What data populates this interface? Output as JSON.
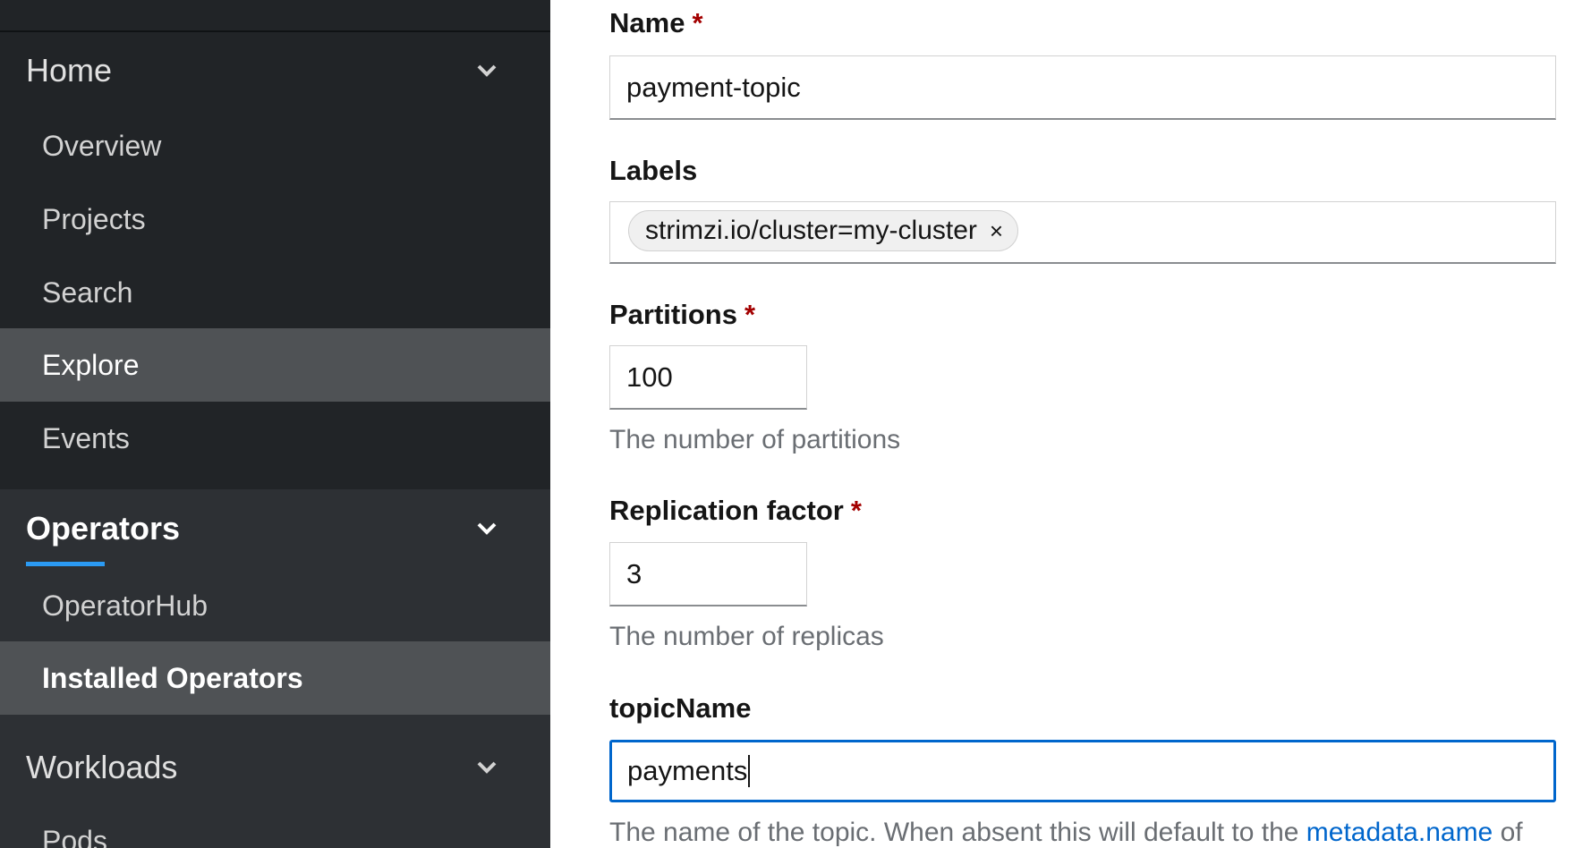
{
  "sidebar": {
    "home": {
      "label": "Home",
      "items": [
        {
          "label": "Overview"
        },
        {
          "label": "Projects"
        },
        {
          "label": "Search"
        },
        {
          "label": "Explore"
        },
        {
          "label": "Events"
        }
      ]
    },
    "operators": {
      "label": "Operators",
      "items": [
        {
          "label": "OperatorHub"
        },
        {
          "label": "Installed Operators"
        }
      ]
    },
    "workloads": {
      "label": "Workloads",
      "items": [
        {
          "label": "Pods"
        }
      ]
    }
  },
  "form": {
    "name": {
      "label": "Name",
      "required": "*",
      "value": "payment-topic"
    },
    "labels": {
      "label": "Labels",
      "chips": [
        "strimzi.io/cluster=my-cluster"
      ],
      "chip_close": "×"
    },
    "partitions": {
      "label": "Partitions",
      "required": "*",
      "value": "100",
      "help": "The number of partitions"
    },
    "replication": {
      "label": "Replication factor",
      "required": "*",
      "value": "3",
      "help": "The number of replicas"
    },
    "topic_name": {
      "label": "topicName",
      "value": "payments",
      "help_prefix": "The name of the topic. When absent this will default to the ",
      "help_link": "metadata.name",
      "help_suffix": " of"
    }
  },
  "colors": {
    "sidebar_bg": "#212427",
    "section_bg": "#2d3034",
    "active_bg": "#4f5255",
    "accent": "#2b9af3",
    "focus_border": "#0066cc",
    "required": "#a30000"
  }
}
